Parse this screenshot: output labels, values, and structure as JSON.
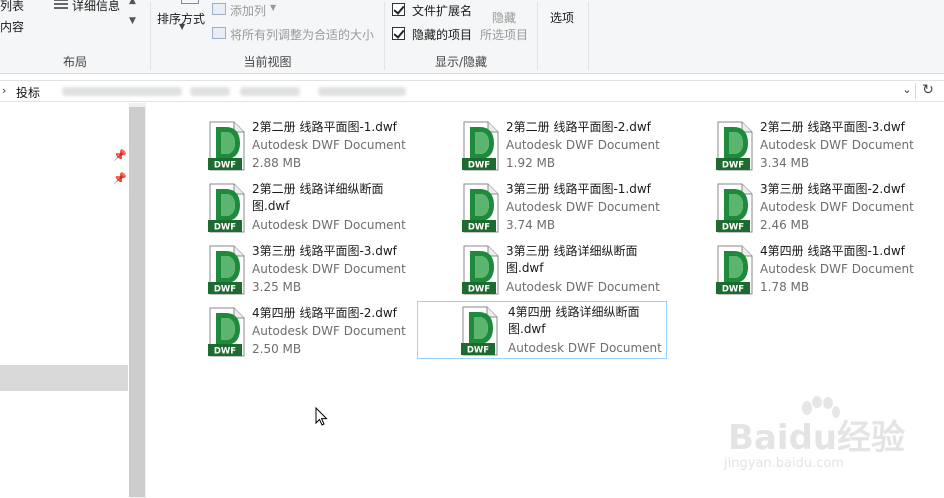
{
  "ribbon": {
    "layout_group": {
      "items": [
        "列表",
        "详细信息",
        "内容"
      ],
      "label": "布局"
    },
    "current_view_group": {
      "sort_label": "排序方式",
      "add_column_label": "添加列",
      "fit_columns_label": "将所有列调整为合适的大小",
      "label": "当前视图"
    },
    "show_hide_group": {
      "file_ext_label": "文件扩展名",
      "hidden_items_label": "隐藏的项目",
      "hide_label": "隐藏",
      "hide_selected_label": "所选项目",
      "label": "显示/隐藏"
    },
    "options_label": "选项"
  },
  "address": {
    "chevron": "›",
    "segment": "投标",
    "dropdown_glyph": "⌄",
    "refresh_glyph": "↻"
  },
  "files": [
    {
      "name": "2第二册 线路平面图-1.dwf",
      "type": "Autodesk DWF Document",
      "size": "2.88 MB"
    },
    {
      "name": "2第二册 线路平面图-2.dwf",
      "type": "Autodesk DWF Document",
      "size": "1.92 MB"
    },
    {
      "name": "2第二册 线路平面图-3.dwf",
      "type": "Autodesk DWF Document",
      "size": "3.34 MB"
    },
    {
      "name": "2第二册 线路详细纵断面图.dwf",
      "type": "Autodesk DWF Document",
      "size": ""
    },
    {
      "name": "3第三册 线路平面图-1.dwf",
      "type": "Autodesk DWF Document",
      "size": "3.74 MB"
    },
    {
      "name": "3第三册 线路平面图-2.dwf",
      "type": "Autodesk DWF Document",
      "size": "2.46 MB"
    },
    {
      "name": "3第三册 线路平面图-3.dwf",
      "type": "Autodesk DWF Document",
      "size": "3.25 MB"
    },
    {
      "name": "3第三册 线路详细纵断面图.dwf",
      "type": "Autodesk DWF Document",
      "size": ""
    },
    {
      "name": "4第四册 线路平面图-1.dwf",
      "type": "Autodesk DWF Document",
      "size": "1.78 MB"
    },
    {
      "name": "4第四册 线路平面图-2.dwf",
      "type": "Autodesk DWF Document",
      "size": "2.50 MB"
    },
    {
      "name": "4第四册 线路详细纵断面图.dwf",
      "type": "Autodesk DWF Document",
      "size": ""
    }
  ],
  "icon_badge": "DWF",
  "watermark": {
    "logo": "Baidu经验",
    "url": "jingyan.baidu.com"
  },
  "colors": {
    "dwf_green": "#1e8a3c",
    "selection_border": "#99d1ff"
  }
}
